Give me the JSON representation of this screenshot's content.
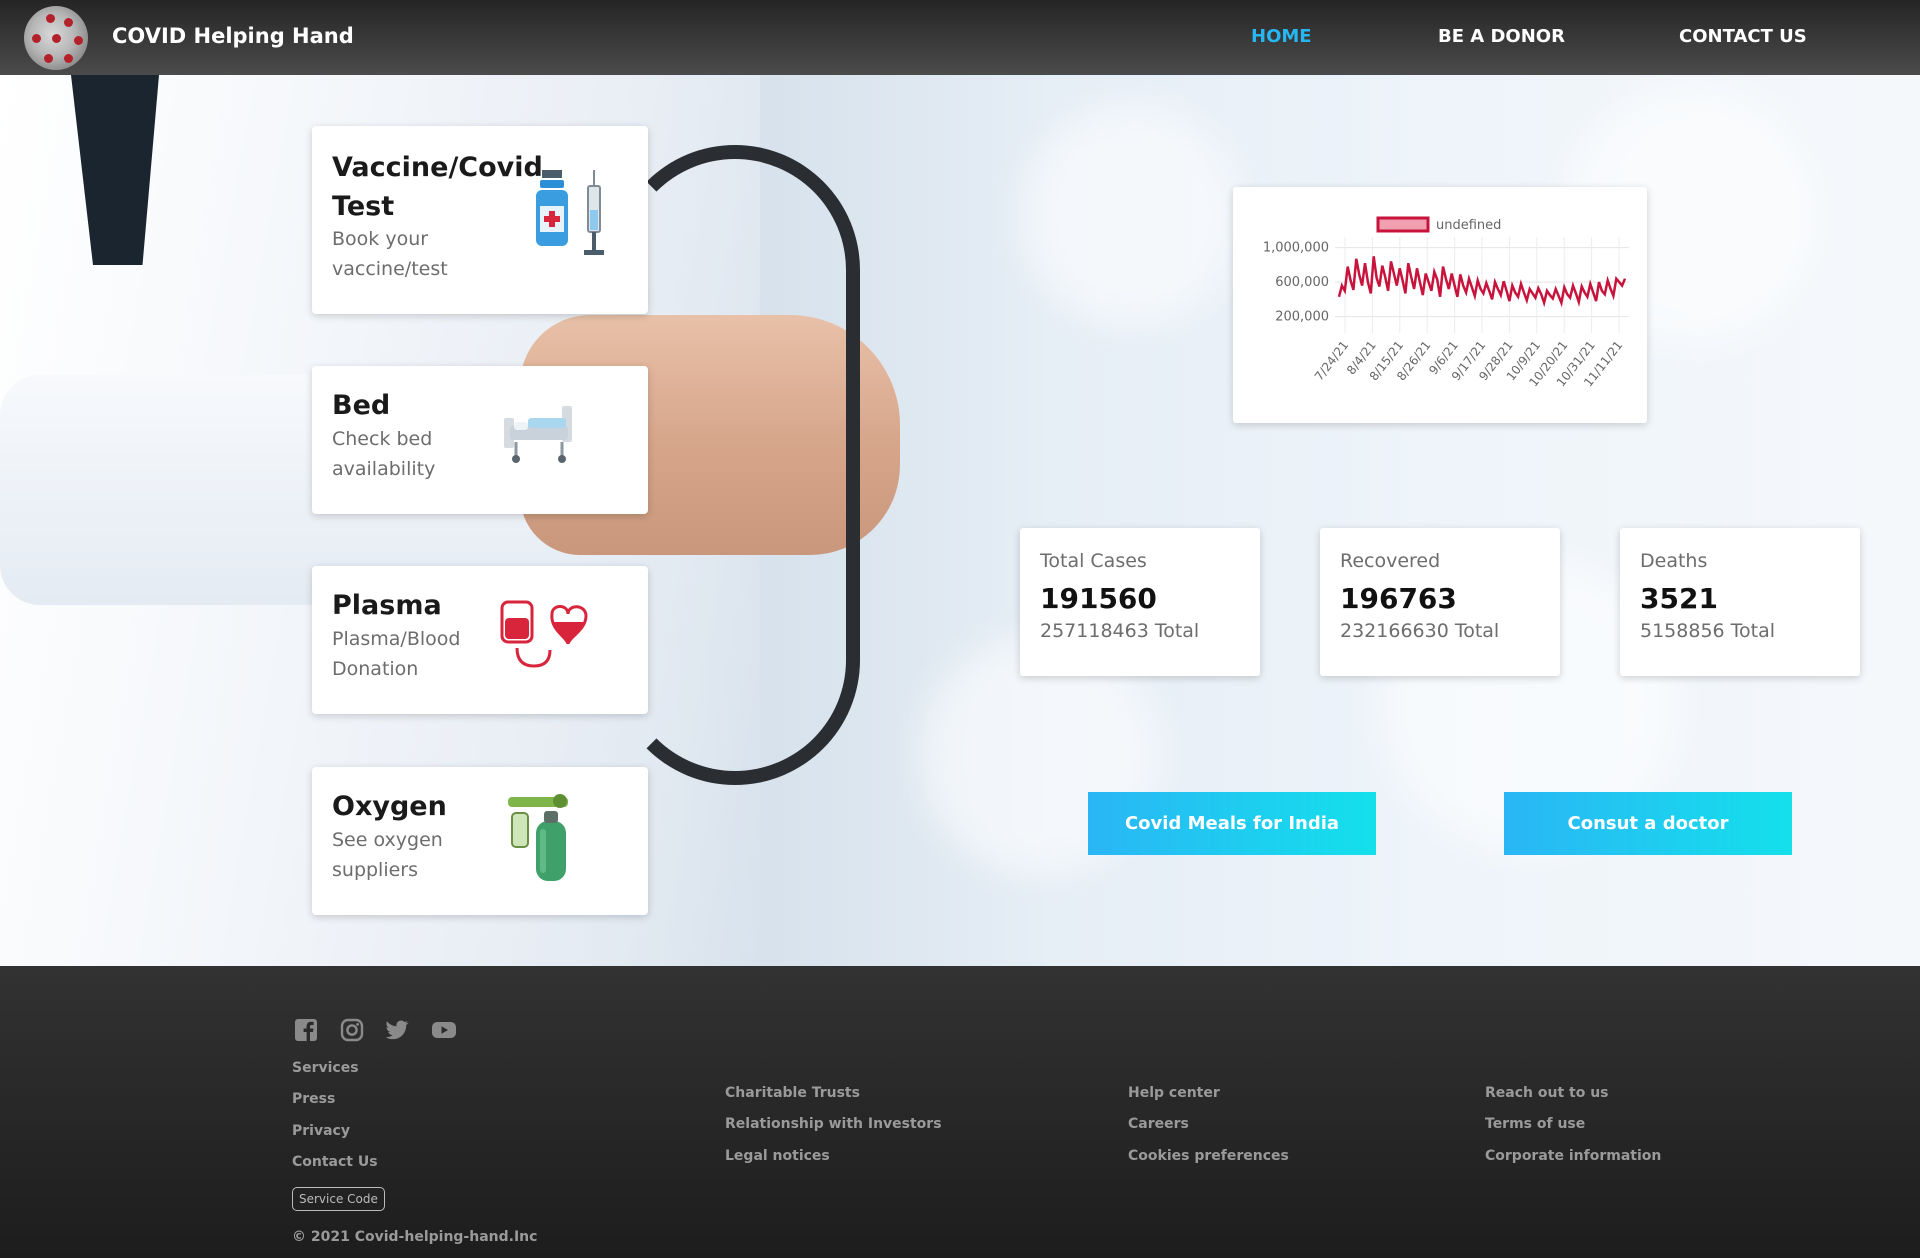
{
  "nav": {
    "brand": "COVID Helping Hand",
    "links": [
      "HOME",
      "BE A DONOR",
      "CONTACT US"
    ],
    "active_color": "#27b6f1"
  },
  "services": [
    {
      "title": "Vaccine/Covid Test",
      "subtitle": "Book your vaccine/test",
      "icon": "vaccine-icon"
    },
    {
      "title": "Bed",
      "subtitle": "Check bed availability",
      "icon": "hospital-bed-icon"
    },
    {
      "title": "Plasma",
      "subtitle": "Plasma/Blood Donation",
      "icon": "blood-donation-icon"
    },
    {
      "title": "Oxygen",
      "subtitle": "See oxygen suppliers",
      "icon": "oxygen-cylinder-icon"
    }
  ],
  "chart_data": {
    "type": "line",
    "legend": "undefined",
    "series_color": "#c8143c",
    "yticks": [
      "1,000,000",
      "600,000",
      "200,000"
    ],
    "ylim": [
      0,
      1100000
    ],
    "xticks": [
      "7/24/21",
      "8/4/21",
      "8/15/21",
      "8/26/21",
      "9/6/21",
      "9/17/21",
      "9/28/21",
      "10/9/21",
      "10/20/21",
      "10/31/21",
      "11/11/21"
    ],
    "values": [
      430000,
      560000,
      500000,
      780000,
      620000,
      510000,
      870000,
      690000,
      560000,
      820000,
      600000,
      470000,
      900000,
      650000,
      550000,
      790000,
      660000,
      500000,
      840000,
      700000,
      560000,
      760000,
      620000,
      470000,
      820000,
      660000,
      520000,
      760000,
      600000,
      450000,
      700000,
      600000,
      500000,
      720000,
      630000,
      430000,
      780000,
      640000,
      520000,
      700000,
      560000,
      430000,
      690000,
      560000,
      480000,
      640000,
      540000,
      440000,
      620000,
      520000,
      470000,
      590000,
      500000,
      400000,
      600000,
      520000,
      450000,
      610000,
      500000,
      380000,
      560000,
      480000,
      430000,
      580000,
      480000,
      390000,
      520000,
      470000,
      420000,
      530000,
      460000,
      360000,
      500000,
      450000,
      410000,
      520000,
      440000,
      360000,
      540000,
      460000,
      420000,
      560000,
      470000,
      370000,
      550000,
      480000,
      430000,
      580000,
      480000,
      380000,
      600000,
      500000,
      460000,
      620000,
      520000,
      440000,
      640000,
      600000,
      560000,
      640000
    ]
  },
  "stats": [
    {
      "label": "Total Cases",
      "value": "191560",
      "total": "257118463 Total"
    },
    {
      "label": "Recovered",
      "value": "196763",
      "total": "232166630 Total"
    },
    {
      "label": "Deaths",
      "value": "3521",
      "total": "5158856 Total"
    }
  ],
  "actions": [
    "Covid Meals for India",
    "Consut a doctor"
  ],
  "footer": {
    "social": [
      "facebook-icon",
      "instagram-icon",
      "twitter-icon",
      "youtube-icon"
    ],
    "col1": [
      "Services",
      "Press",
      "Privacy",
      "Contact Us"
    ],
    "col2": [
      "Charitable Trusts",
      "Relationship with Investors",
      "Legal notices"
    ],
    "col3": [
      "Help center",
      "Careers",
      "Cookies preferences"
    ],
    "col4": [
      "Reach out to us",
      "Terms of use",
      "Corporate information"
    ],
    "service_code": "Service Code",
    "copyright": "© 2021 Covid-helping-hand.Inc"
  }
}
